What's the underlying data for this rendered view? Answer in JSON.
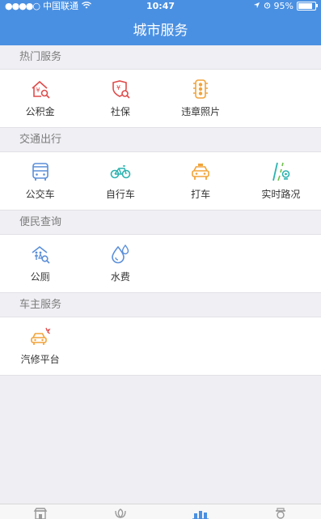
{
  "status_bar": {
    "signal_dots": "●●●●○",
    "carrier": "中国联通",
    "wifi_icon": "wifi-icon",
    "time": "10:47",
    "battery_percent": "95%",
    "battery_level": 0.95
  },
  "navbar": {
    "title": "城市服务"
  },
  "sections": [
    {
      "title": "热门服务",
      "items": [
        {
          "label": "公积金",
          "icon": "housing-fund-icon"
        },
        {
          "label": "社保",
          "icon": "social-security-icon"
        },
        {
          "label": "违章照片",
          "icon": "traffic-light-icon"
        }
      ]
    },
    {
      "title": "交通出行",
      "items": [
        {
          "label": "公交车",
          "icon": "bus-icon"
        },
        {
          "label": "自行车",
          "icon": "bicycle-icon"
        },
        {
          "label": "打车",
          "icon": "taxi-icon"
        },
        {
          "label": "实时路况",
          "icon": "road-camera-icon"
        }
      ]
    },
    {
      "title": "便民查询",
      "items": [
        {
          "label": "公厕",
          "icon": "restroom-icon"
        },
        {
          "label": "水费",
          "icon": "water-drop-icon"
        }
      ]
    },
    {
      "title": "车主服务",
      "items": [
        {
          "label": "汽修平台",
          "icon": "car-repair-icon"
        }
      ]
    }
  ],
  "colors": {
    "primary": "#4a90e2",
    "red": "#e04b4b",
    "orange": "#f2a33a",
    "teal": "#2db3b0",
    "blue": "#5b8fd9",
    "green": "#6cc04a"
  },
  "tabbar": [
    {
      "icon": "city-gate-icon"
    },
    {
      "icon": "flower-icon"
    },
    {
      "icon": "city-services-icon",
      "active": true
    },
    {
      "icon": "profile-icon"
    }
  ]
}
